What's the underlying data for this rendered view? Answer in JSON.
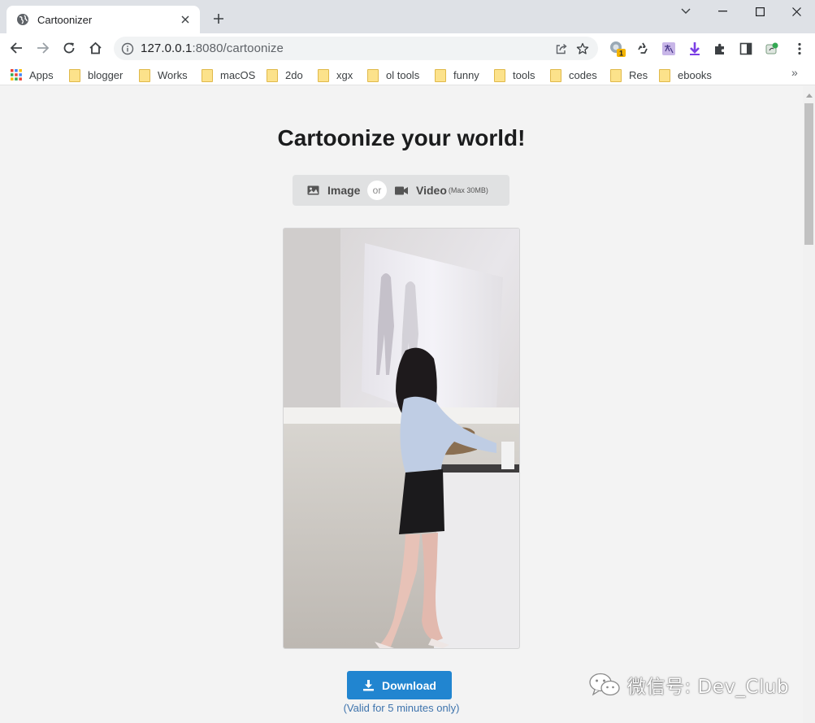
{
  "tab": {
    "title": "Cartoonizer"
  },
  "address": {
    "host": "127.0.0.1",
    "rest": ":8080/cartoonize"
  },
  "extensions": {
    "badge_count": "1"
  },
  "bookmarks": [
    {
      "label": "Apps",
      "kind": "apps"
    },
    {
      "label": "blogger"
    },
    {
      "label": "Works"
    },
    {
      "label": "macOS"
    },
    {
      "label": "2do"
    },
    {
      "label": "xgx"
    },
    {
      "label": "ol tools"
    },
    {
      "label": "funny"
    },
    {
      "label": "tools"
    },
    {
      "label": "codes"
    },
    {
      "label": "Res"
    },
    {
      "label": "ebooks"
    }
  ],
  "page": {
    "heading": "Cartoonize your world!",
    "image_button": "Image",
    "or_label": "or",
    "video_button": "Video",
    "video_limit": "(Max 30MB)",
    "download_button": "Download",
    "validity_note": "(Valid for 5 minutes only)"
  },
  "watermark": {
    "text": "微信号: Dev_Club"
  },
  "colors": {
    "primary": "#2185d0",
    "tab_strip": "#dee1e6",
    "page_bg": "#f3f3f3",
    "note_text": "#3f74ad"
  }
}
